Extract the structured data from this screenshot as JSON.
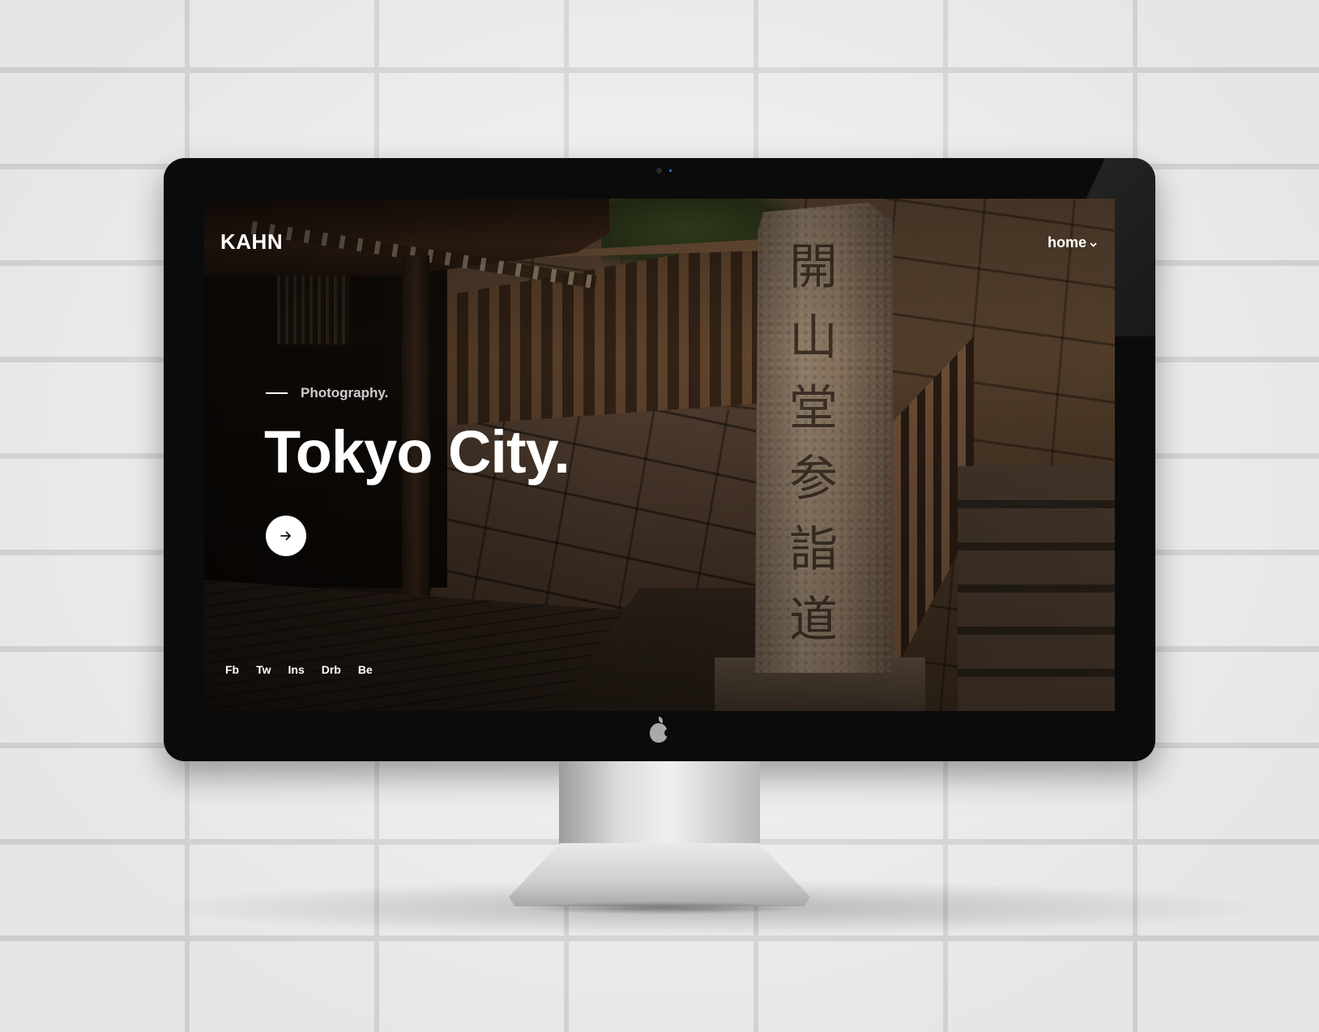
{
  "site": {
    "logo": "KAHN",
    "nav": {
      "home_label": "home",
      "home_chevron_icon": "chevron-down-icon"
    }
  },
  "hero": {
    "kicker": "Photography.",
    "title": "Tokyo City.",
    "cta_icon": "arrow-right-icon"
  },
  "background_photo": {
    "pillar_inscription": [
      "開",
      "山",
      "堂",
      "参",
      "詣",
      "道"
    ]
  },
  "social": {
    "links": [
      "Fb",
      "Tw",
      "Ins",
      "Drb",
      "Be"
    ]
  },
  "colors": {
    "text": "#ffffff",
    "button_bg": "#ffffff",
    "button_icon": "#111111",
    "monitor_bezel": "#0b0b0b"
  }
}
